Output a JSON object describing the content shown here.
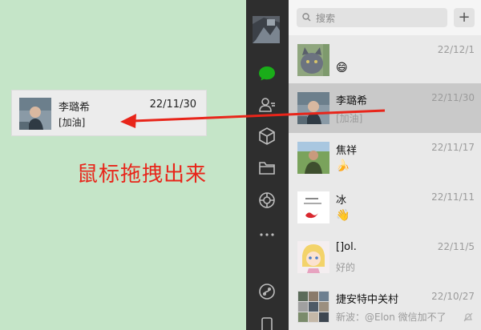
{
  "drag_card": {
    "name": "李璐希",
    "date": "22/11/30",
    "message": "[加油]"
  },
  "caption": "鼠标拖拽出来",
  "sidebar": {
    "icons": [
      "chat-icon",
      "contacts-icon",
      "box-icon",
      "folder-icon",
      "moments-icon",
      "more-icon",
      "mini-program-icon",
      "phone-icon"
    ]
  },
  "search": {
    "placeholder": "搜索"
  },
  "add_button": "+",
  "chats": [
    {
      "title": "",
      "date": "22/12/1",
      "preview": "😄"
    },
    {
      "title": "李璐希",
      "date": "22/11/30",
      "preview": "[加油]"
    },
    {
      "title": "焦祥",
      "date": "22/11/17",
      "preview": "🍌"
    },
    {
      "title": "冰",
      "date": "22/11/11",
      "preview": "👋"
    },
    {
      "title": "[]ol.",
      "date": "22/11/5",
      "preview": "好的"
    },
    {
      "title": "捷安特中关村",
      "date": "22/10/27",
      "preview": "新波：@Elon 微信加不了"
    }
  ],
  "colors": {
    "caption": "#e8251a",
    "arrow": "#e8251a",
    "wechat_green": "#1aad19"
  }
}
